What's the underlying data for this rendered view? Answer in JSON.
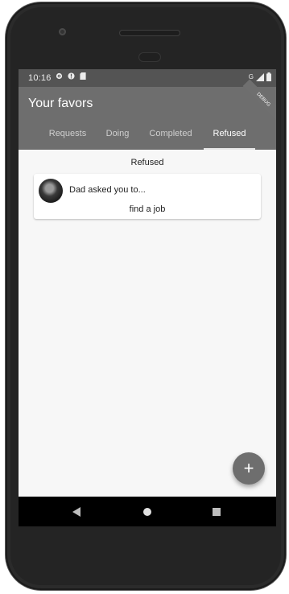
{
  "status_bar": {
    "time": "10:16",
    "network": "G"
  },
  "app_bar": {
    "title": "Your favors",
    "debug_label": "DEBUG"
  },
  "tabs": [
    {
      "label": "Requests"
    },
    {
      "label": "Doing"
    },
    {
      "label": "Completed"
    },
    {
      "label": "Refused",
      "active": true
    }
  ],
  "section": {
    "title": "Refused"
  },
  "favors": [
    {
      "header": "Dad asked you to...",
      "description": "find a job"
    }
  ],
  "fab": {
    "icon": "plus-icon",
    "label": "+"
  },
  "nav": {
    "back_icon": "back-triangle-icon",
    "home_icon": "home-circle-icon",
    "recents_icon": "recents-square-icon"
  }
}
